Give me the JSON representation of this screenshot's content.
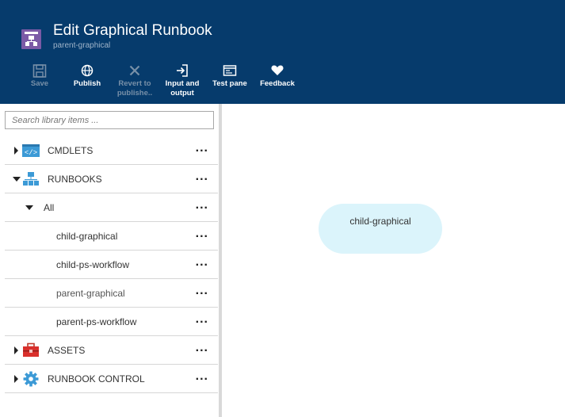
{
  "header": {
    "title": "Edit Graphical Runbook",
    "subtitle": "parent-graphical",
    "toolbar": {
      "save": "Save",
      "publish": "Publish",
      "revert_line1": "Revert to",
      "revert_line2": "publishe..",
      "io_line1": "Input and",
      "io_line2": "output",
      "test_pane": "Test pane",
      "feedback": "Feedback"
    }
  },
  "library": {
    "search_placeholder": "Search library items ...",
    "more": "...",
    "items": {
      "cmdlets": "CMDLETS",
      "runbooks": "RUNBOOKS",
      "all": "All",
      "child_graphical": "child-graphical",
      "child_ps_workflow": "child-ps-workflow",
      "parent_graphical": "parent-graphical",
      "parent_ps_workflow": "parent-ps-workflow",
      "assets": "ASSETS",
      "runbook_control": "RUNBOOK CONTROL"
    }
  },
  "canvas": {
    "node_label": "child-graphical"
  },
  "colors": {
    "header_bg": "#063b6c",
    "app_icon": "#7b5aa6",
    "node_fill": "#dbf4fb"
  }
}
